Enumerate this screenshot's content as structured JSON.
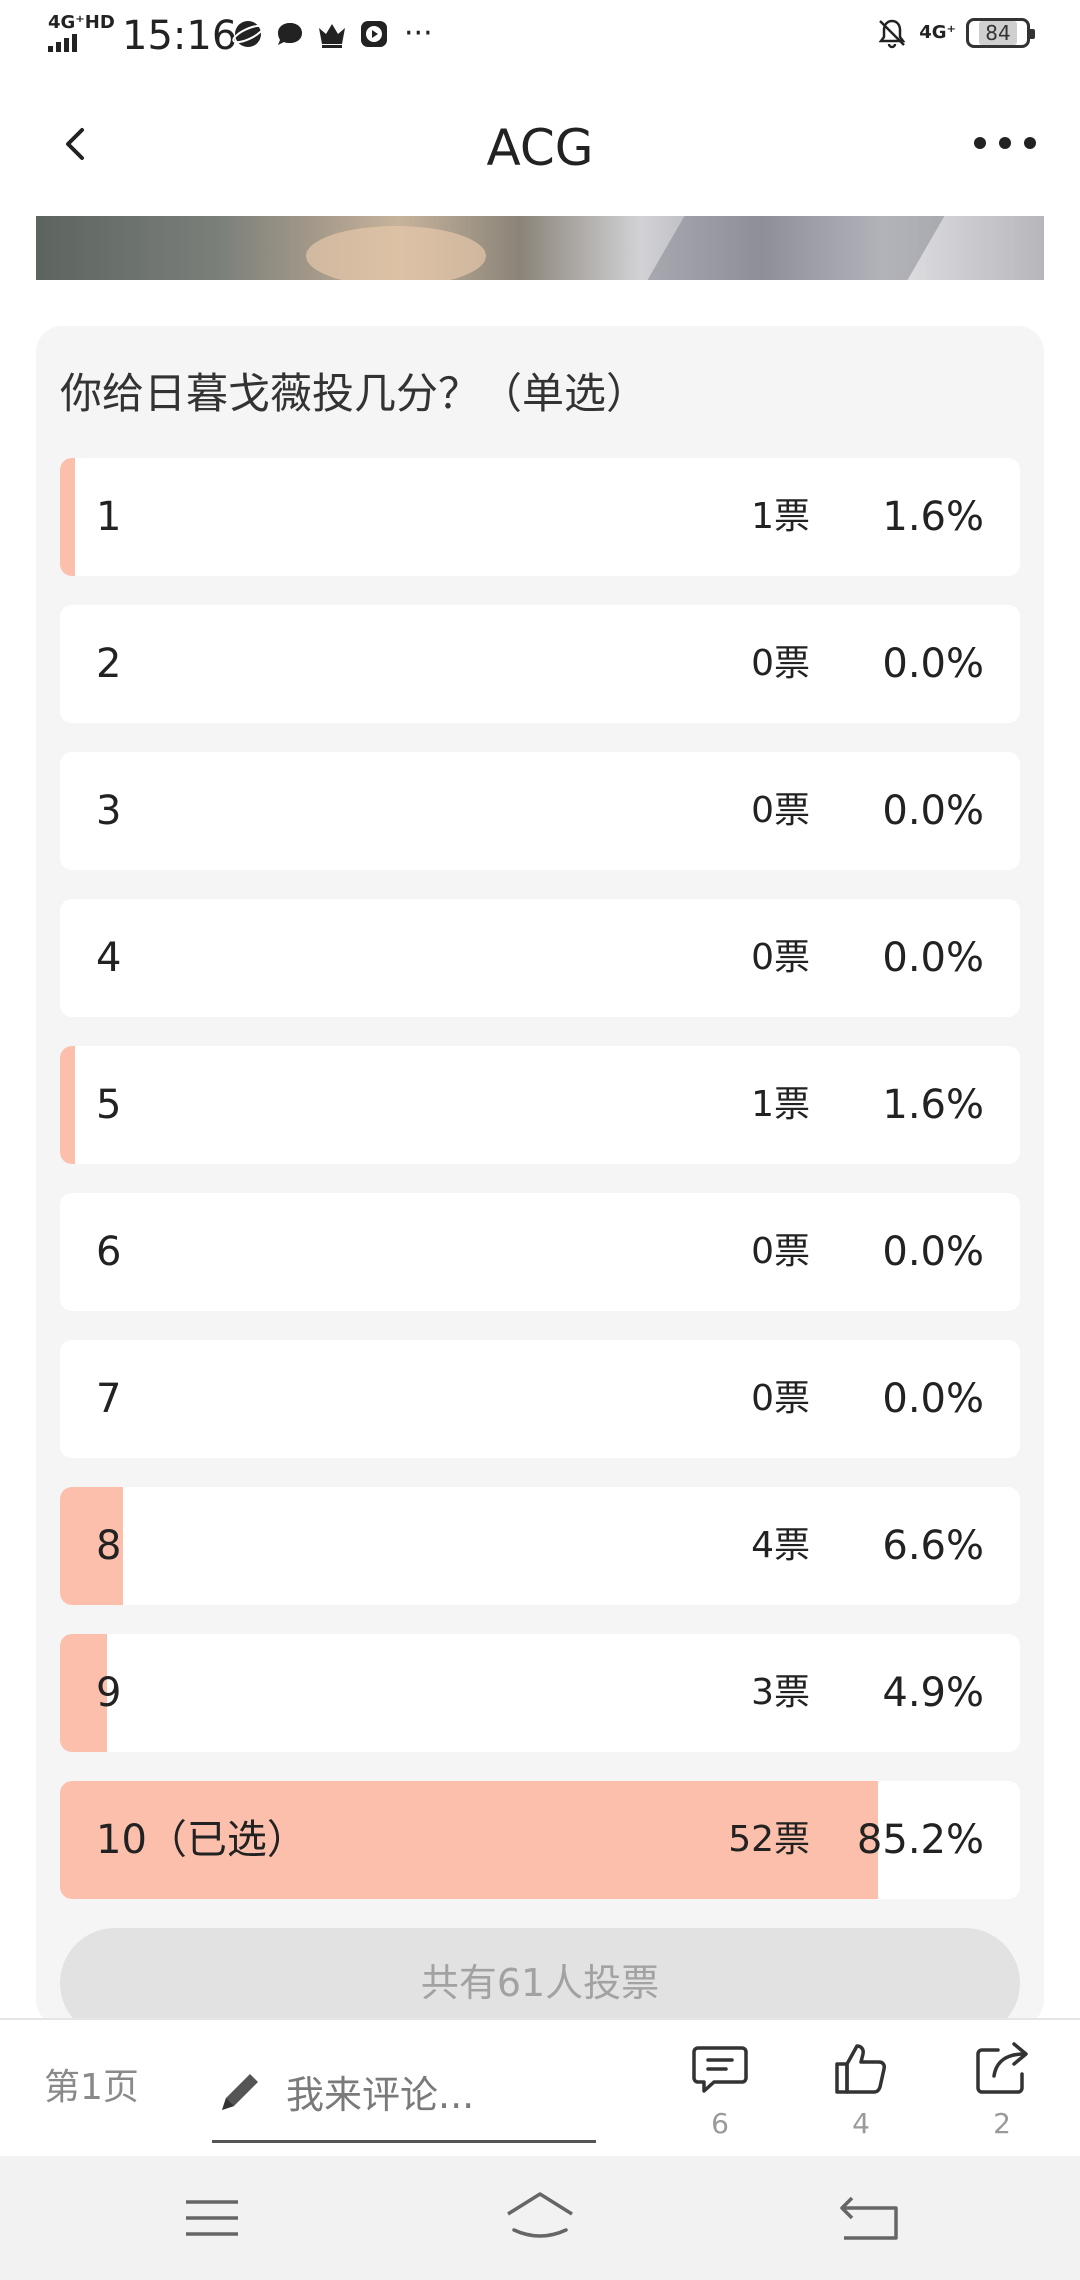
{
  "status_bar": {
    "network_left": "4G⁺HD",
    "time": "15:16",
    "network_right": "4G⁺",
    "battery": "84",
    "more": "···"
  },
  "header": {
    "title": "ACG"
  },
  "poll": {
    "question": "你给日暮戈薇投几分？（单选）",
    "options": [
      {
        "label": "1",
        "votes": "1票",
        "percent": "1.6%",
        "share": 0.016
      },
      {
        "label": "2",
        "votes": "0票",
        "percent": "0.0%",
        "share": 0.0
      },
      {
        "label": "3",
        "votes": "0票",
        "percent": "0.0%",
        "share": 0.0
      },
      {
        "label": "4",
        "votes": "0票",
        "percent": "0.0%",
        "share": 0.0
      },
      {
        "label": "5",
        "votes": "1票",
        "percent": "1.6%",
        "share": 0.016
      },
      {
        "label": "6",
        "votes": "0票",
        "percent": "0.0%",
        "share": 0.0
      },
      {
        "label": "7",
        "votes": "0票",
        "percent": "0.0%",
        "share": 0.0
      },
      {
        "label": "8",
        "votes": "4票",
        "percent": "6.6%",
        "share": 0.066
      },
      {
        "label": "9",
        "votes": "3票",
        "percent": "4.9%",
        "share": 0.049
      },
      {
        "label": "10（已选）",
        "votes": "52票",
        "percent": "85.2%",
        "share": 0.852
      }
    ],
    "total_label": "共有61人投票",
    "fill_color": "#fcbfab"
  },
  "action_bar": {
    "page_label": "第1页",
    "comment_placeholder": "我来评论...",
    "comments_count": "6",
    "likes_count": "4",
    "shares_count": "2"
  },
  "icons": {
    "back": "chevron-left-icon",
    "more": "more-dots-icon",
    "pencil": "pencil-icon",
    "comment": "comment-icon",
    "like": "thumbs-up-icon",
    "share": "share-icon",
    "nav_menu": "menu-icon",
    "nav_home": "home-icon",
    "nav_back": "back-icon"
  }
}
